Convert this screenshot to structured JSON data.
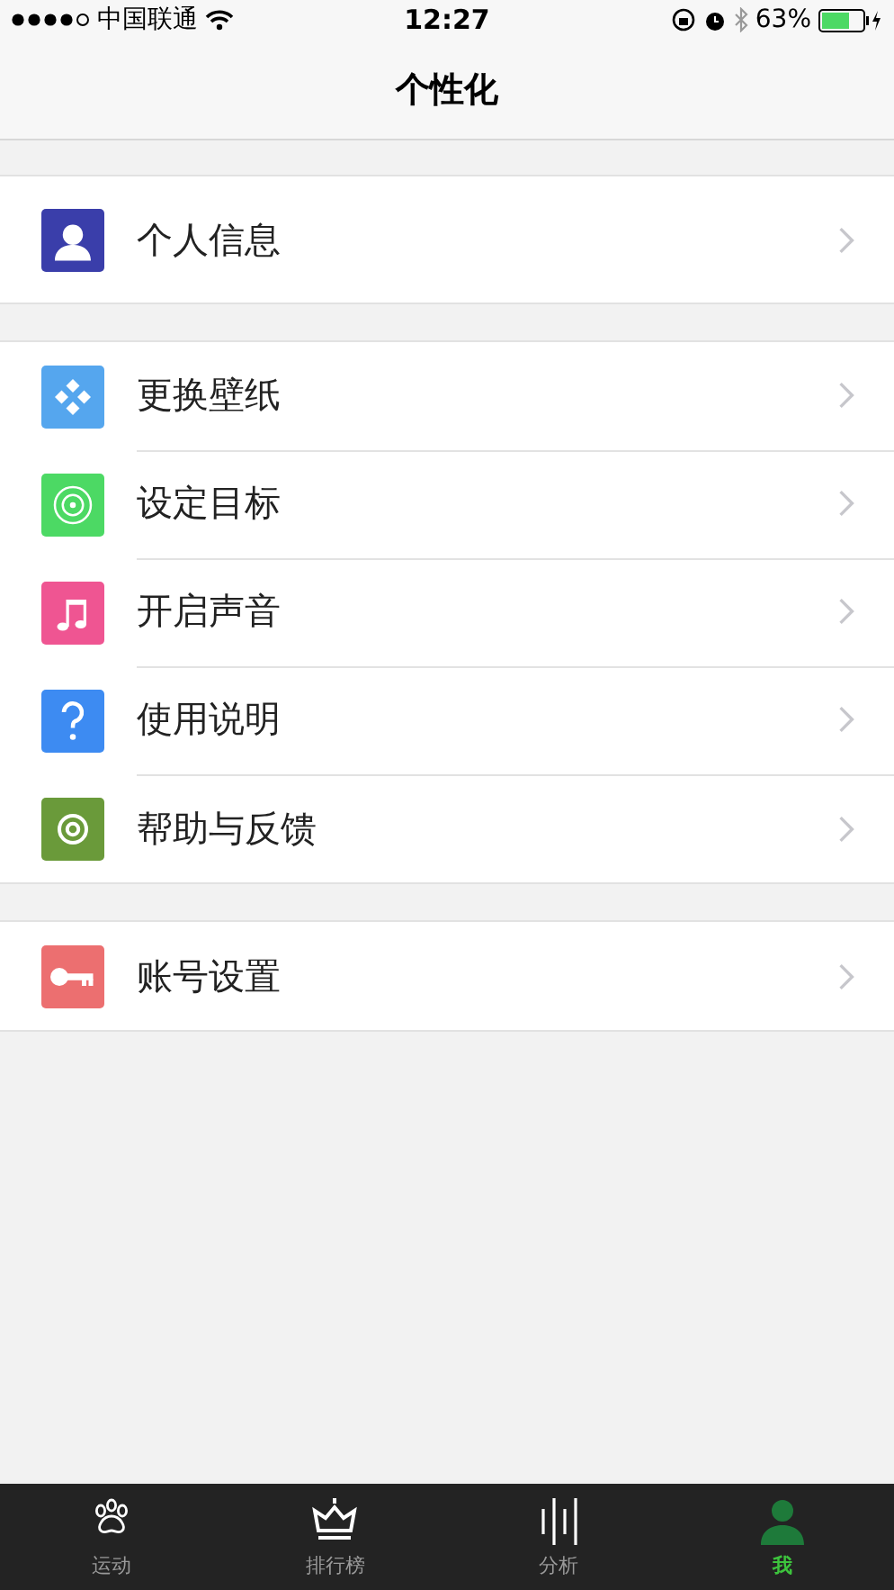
{
  "status_bar": {
    "carrier": "中国联通",
    "time": "12:27",
    "battery": "63%"
  },
  "nav_bar": {
    "title": "个性化"
  },
  "groups": [
    {
      "tall": true,
      "items": [
        {
          "label": "个人信息",
          "color": "#3a3eaa"
        }
      ]
    },
    {
      "tall": false,
      "items": [
        {
          "label": "更换壁纸",
          "color": "#55a6ee"
        },
        {
          "label": "设定目标",
          "color": "#4cd964"
        },
        {
          "label": "开启声音",
          "color": "#ef5592"
        },
        {
          "label": "使用说明",
          "color": "#3d8bf2"
        },
        {
          "label": "帮助与反馈",
          "color": "#6a9a3a"
        }
      ]
    },
    {
      "tall": false,
      "items": [
        {
          "label": "账号设置",
          "color": "#ec6f70"
        }
      ]
    }
  ],
  "tabs": [
    {
      "label": "运动",
      "selected": false
    },
    {
      "label": "排行榜",
      "selected": false
    },
    {
      "label": "分析",
      "selected": false
    },
    {
      "label": "我",
      "selected": true
    }
  ]
}
